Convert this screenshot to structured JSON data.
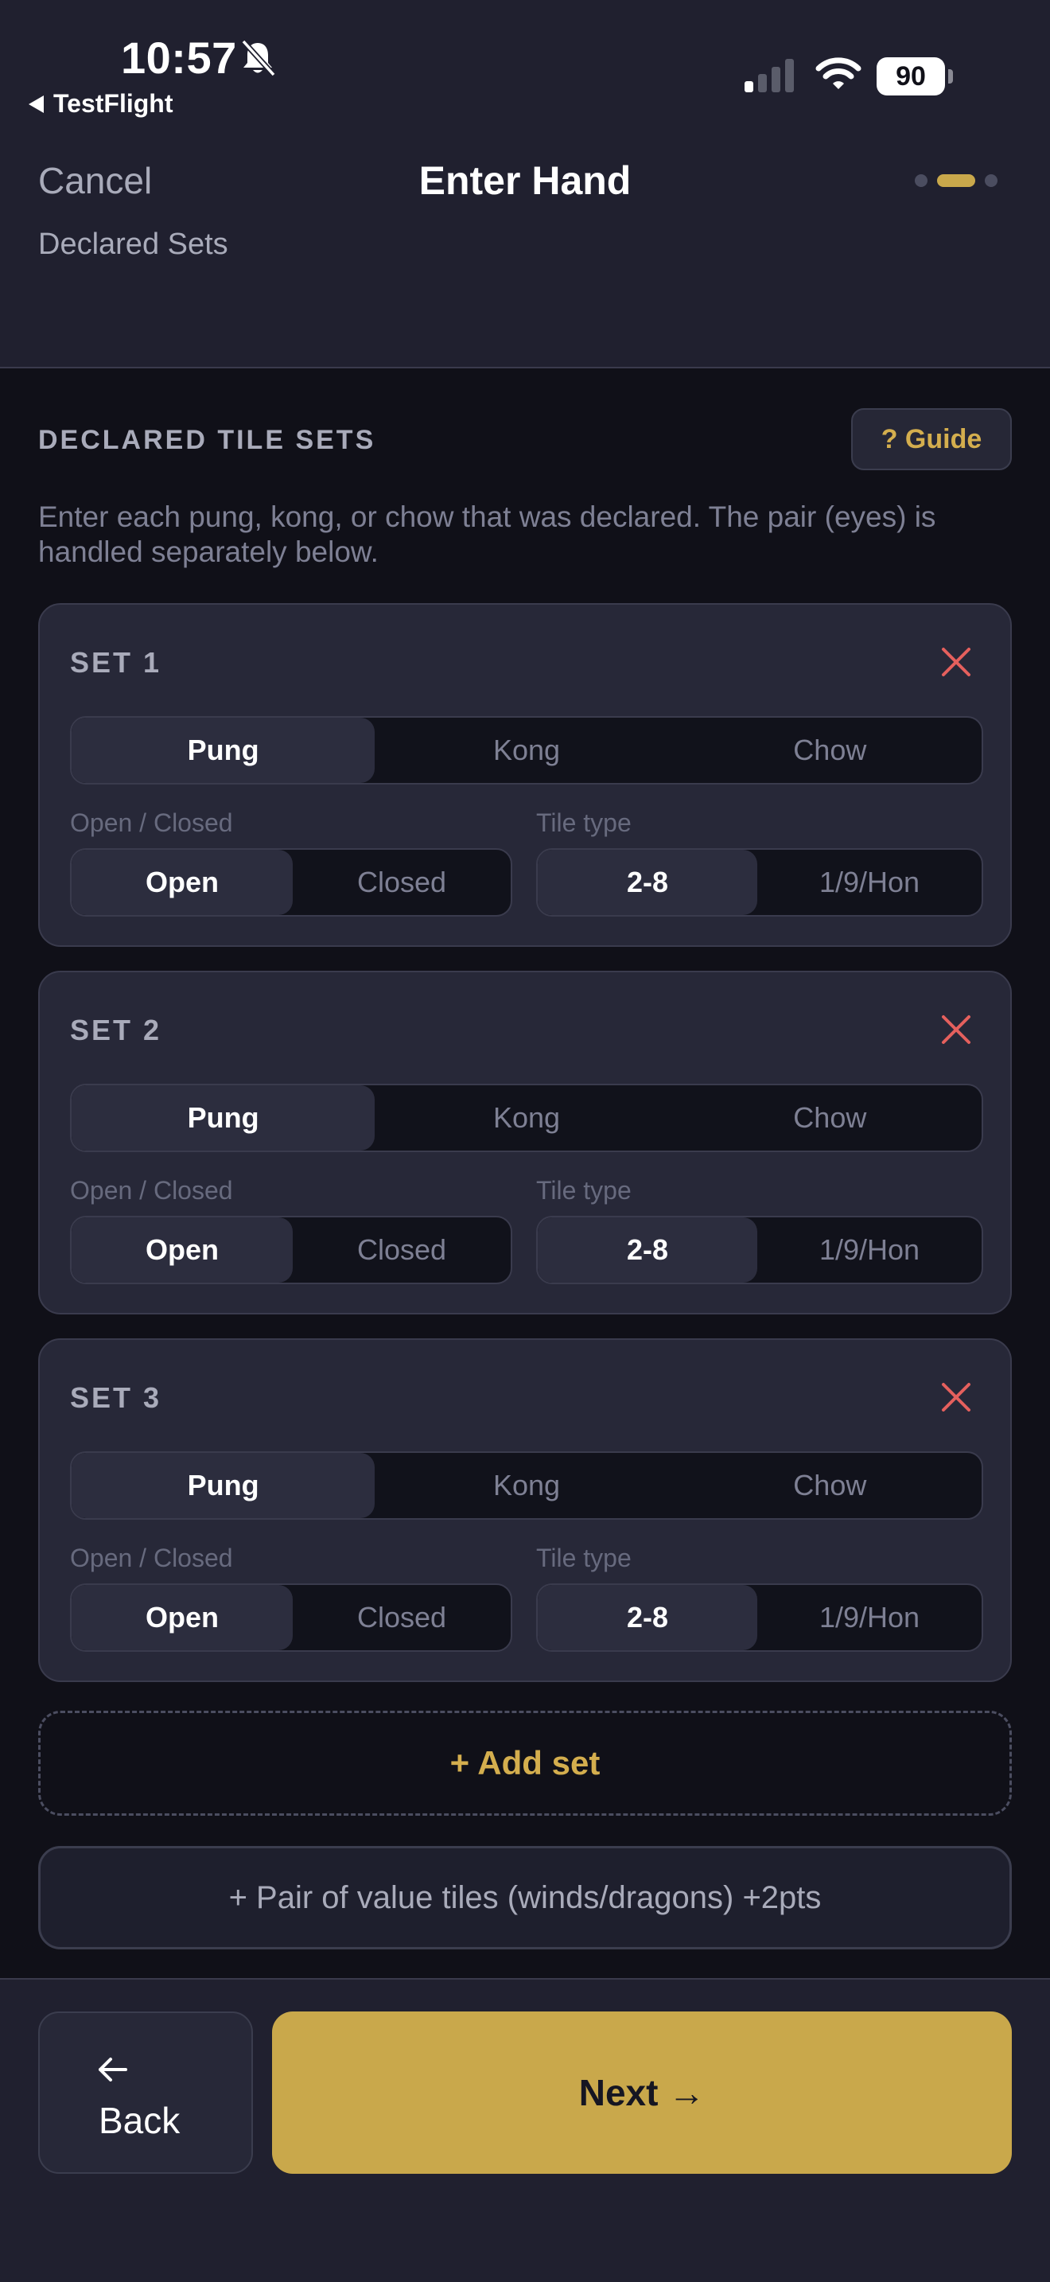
{
  "status_bar": {
    "time": "10:57",
    "back_app": "TestFlight",
    "battery": "90"
  },
  "header": {
    "cancel_label": "Cancel",
    "title": "Enter Hand",
    "subtitle": "Declared Sets",
    "steps": 3,
    "active_step": 2
  },
  "section": {
    "title": "DECLARED TILE SETS",
    "guide_label": "? Guide",
    "description": "Enter each pung, kong, or chow that was declared. The pair (eyes) is handled separately below."
  },
  "sets": [
    {
      "label": "SET 1",
      "types": [
        "Pung",
        "Kong",
        "Chow"
      ],
      "selected_type": "Pung",
      "open_closed_label": "Open / Closed",
      "open_label": "Open",
      "closed_label": "Closed",
      "selected_open_closed": "Open",
      "tile_type_label": "Tile type",
      "simple_label": "2-8",
      "terminal_label": "1/9/Hon",
      "selected_tile_type": "2-8"
    },
    {
      "label": "SET 2",
      "types": [
        "Pung",
        "Kong",
        "Chow"
      ],
      "selected_type": "Pung",
      "open_closed_label": "Open / Closed",
      "open_label": "Open",
      "closed_label": "Closed",
      "selected_open_closed": "Open",
      "tile_type_label": "Tile type",
      "simple_label": "2-8",
      "terminal_label": "1/9/Hon",
      "selected_tile_type": "2-8"
    },
    {
      "label": "SET 3",
      "types": [
        "Pung",
        "Kong",
        "Chow"
      ],
      "selected_type": "Pung",
      "open_closed_label": "Open / Closed",
      "open_label": "Open",
      "closed_label": "Closed",
      "selected_open_closed": "Open",
      "tile_type_label": "Tile type",
      "simple_label": "2-8",
      "terminal_label": "1/9/Hon",
      "selected_tile_type": "2-8"
    }
  ],
  "add_set_label": "+ Add set",
  "pair_button_label": "+ Pair of value tiles (winds/dragons) +2pts",
  "footer": {
    "back_label": "Back",
    "next_label": "Next →"
  },
  "colors": {
    "accent": "#c9a84b",
    "remove": "#e5605d",
    "background": "#101018",
    "panel": "#20202f"
  },
  "icons": [
    "bell-slash-icon",
    "signal-icon",
    "wifi-icon",
    "close-icon",
    "arrow-left-icon"
  ]
}
